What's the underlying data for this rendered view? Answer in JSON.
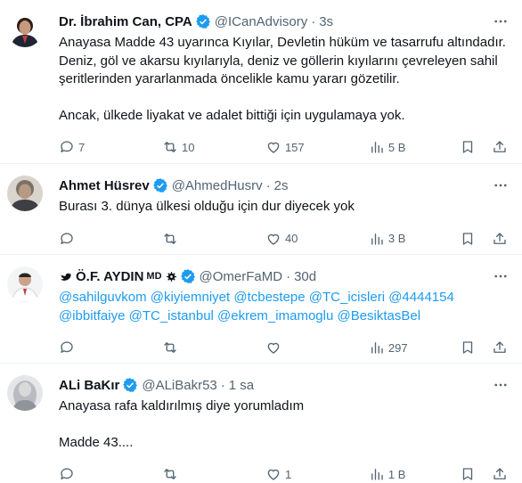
{
  "tweets": [
    {
      "name": "Dr. İbrahim Can, CPA",
      "handle": "@ICanAdvisory",
      "time": "3s",
      "body": [
        "Anayasa Madde 43 uyarınca Kıyılar, Devletin hüküm ve tasarrufu altındadır.",
        "Deniz, göl ve akarsu kıyılarıyla, deniz ve göllerin kıyılarını çevreleyen sahil",
        "şeritlerinden yararlanmada öncelikle kamu yararı gözetilir.",
        "",
        "Ancak, ülkede liyakat ve adalet bittiği için uygulamaya yok."
      ],
      "replies": "7",
      "retweets": "10",
      "likes": "157",
      "views": "5 B"
    },
    {
      "name": "Ahmet Hüsrev",
      "handle": "@AhmedHusrv",
      "time": "2s",
      "body": [
        "Burası 3. dünya ülkesi olduğu için dur diyecek yok"
      ],
      "replies": "",
      "retweets": "",
      "likes": "40",
      "views": "3 B"
    },
    {
      "name_prefix": "🐦",
      "name": "Ö.F. AYDIN",
      "name_suffix": "MD",
      "handle": "@OmerFaMD",
      "time": "30d",
      "body": [
        "@sahilguvkom @kiyiemniyet @tcbestepe @TC_icisleri @4444154",
        "@ibbitfaiye @TC_istanbul @ekrem_imamoglu @BesiktasBel"
      ],
      "replies": "",
      "retweets": "",
      "likes": "",
      "views": "297"
    },
    {
      "name": "ALi BaKır",
      "handle": "@ALiBakr53",
      "time": "1 sa",
      "body": [
        "Anayasa rafa kaldırılmış diye yorumladım",
        "",
        "Madde 43...."
      ],
      "replies": "",
      "retweets": "",
      "likes": "1",
      "views": "1 B"
    }
  ],
  "colors": {
    "accent": "#1d9bf0",
    "text": "#0f1419",
    "muted": "#536471",
    "divider": "#eff3f4"
  },
  "icons": [
    "reply-icon",
    "retweet-icon",
    "like-icon",
    "views-icon",
    "bookmark-icon",
    "share-icon",
    "more-icon",
    "verified-badge-icon"
  ]
}
